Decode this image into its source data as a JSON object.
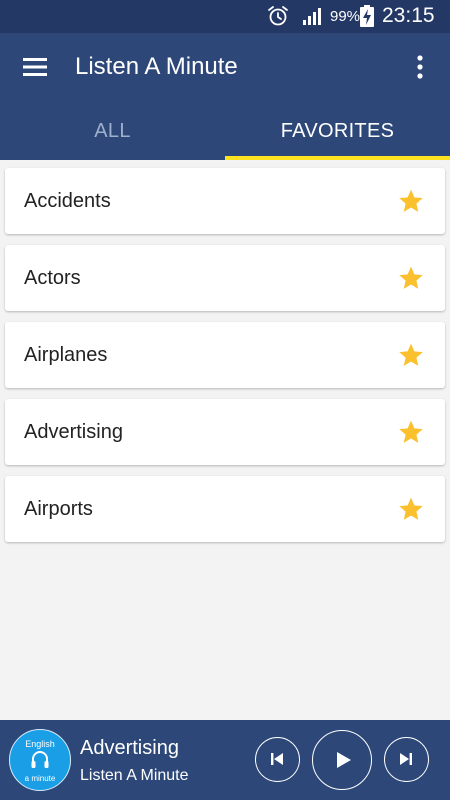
{
  "status_bar": {
    "battery_percent": "99%",
    "time": "23:15",
    "icons": [
      "alarm-icon",
      "signal-icon",
      "battery-charging-icon"
    ]
  },
  "app_bar": {
    "title": "Listen A Minute",
    "menu_icon": "hamburger-menu-icon",
    "overflow_icon": "more-vert-icon"
  },
  "tabs": [
    {
      "label": "ALL",
      "selected": false
    },
    {
      "label": "FAVORITES",
      "selected": true
    }
  ],
  "favorites": [
    {
      "label": "Accidents",
      "favorited": true
    },
    {
      "label": "Actors",
      "favorited": true
    },
    {
      "label": "Airplanes",
      "favorited": true
    },
    {
      "label": "Advertising",
      "favorited": true
    },
    {
      "label": "Airports",
      "favorited": true
    }
  ],
  "player": {
    "logo": {
      "top_text": "English",
      "bottom_text": "a minute"
    },
    "track_title": "Advertising",
    "track_subtitle": "Listen A Minute",
    "controls": [
      "skip-previous-icon",
      "play-icon",
      "skip-next-icon"
    ]
  },
  "colors": {
    "app_bar": "#2c4778",
    "status_bar": "#243866",
    "tab_indicator": "#fde21f",
    "star": "#fbc02d",
    "background": "#f3f3f3",
    "logo": "#1a9ee6"
  }
}
